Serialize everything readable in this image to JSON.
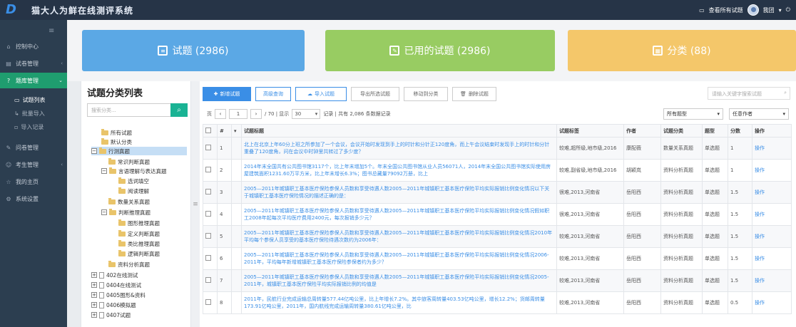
{
  "app": {
    "title": "猫大人为鲜在线测评系统",
    "view_all_label": "查看所有试题",
    "user_name": "我团"
  },
  "sidebar": {
    "items": [
      {
        "label": "控制中心",
        "icon": "home-icon"
      },
      {
        "label": "试卷管理",
        "icon": "doc-icon"
      },
      {
        "label": "题库管理",
        "icon": "help-circle-icon"
      },
      {
        "label": "问卷管理",
        "icon": "edit-icon"
      },
      {
        "label": "考生管理",
        "icon": "user-icon"
      },
      {
        "label": "我的主页",
        "icon": "star-icon"
      },
      {
        "label": "系统设置",
        "icon": "gear-icon"
      }
    ],
    "sub_items": [
      "试题列表",
      "批量导入",
      "导入记录"
    ]
  },
  "cards": [
    {
      "label": "试题 (2986)",
      "color": "#5ba8e5"
    },
    {
      "label": "已用的试题 (2986)",
      "color": "#98cc62"
    },
    {
      "label": "分类 (88)",
      "color": "#f4c76a"
    }
  ],
  "tree": {
    "title": "试题分类列表",
    "search_placeholder": "搜索分类...",
    "nodes": [
      "所有试题",
      "默认分类",
      "行测真题",
      "常识判断真题",
      "言语理解与表达真题",
      "选词填空",
      "阅读理解",
      "数量关系真题",
      "判断推理真题",
      "图形推理真题",
      "定义判断真题",
      "类比推理真题",
      "逻辑判断真题",
      "资料分析真题",
      "402在线测试",
      "0404在线测试",
      "0405图形&资料",
      "0406模拟题",
      "0407试题"
    ]
  },
  "toolbar": {
    "new_label": "新增试题",
    "search_label": "高级查询",
    "import_label": "导入试题",
    "export_label": "导出所选试题",
    "move_label": "移动到分类",
    "delete_label": "删除试题",
    "keyword_placeholder": "请输入关键字搜索试题"
  },
  "pager": {
    "page_prefix": "页",
    "prev": "‹",
    "current": "1",
    "next": "›",
    "of_text": "/ 70 | 显示",
    "page_size": "30",
    "records_text": "记录 | 共有 2,086 条数据记录"
  },
  "filters": {
    "type": "所有题型",
    "author": "任意作者"
  },
  "table": {
    "headers": [
      "#",
      "试题标题",
      "试题标签",
      "作者",
      "试题分类",
      "题型",
      "分数",
      "操作"
    ],
    "rows": [
      {
        "no": "1",
        "title": "北上在北京上年60分上班之所参加了一个会议，会议开始时发现到手上的时针和分针正120度角，而上午会议结束时发现手上的时针和分针重叠了120度角，问在会议中时钟里共转过了多少度？",
        "tags": "较难,超所级,地市级,2016",
        "author": "康配薇",
        "category": "数量关系真题",
        "type": "单选题",
        "score": "1",
        "op": "操作"
      },
      {
        "no": "2",
        "title": "2014年末全国共有公共图书馆3117个，比上年末增加5个。年末全国公共图书馆从业人员56071人，2014年末全国公共图书馆实际使用房屋建筑面积1231.60万平方米，比上年末增长6.3%；图书总藏量79092万册，比上",
        "tags": "较难,副省级,地市级,2016",
        "author": "胡颖岚",
        "category": "资料分析真题",
        "type": "单选题",
        "score": "1",
        "op": "操作"
      },
      {
        "no": "3",
        "title": "2005—2011年城镇职工基本医疗保险参保人员数和享受待遇人数2005—2011年城镇职工基本医疗保险平均实际报销比例变化情况以下关于城镇职工基本医疗保险情况的描述正确的是：",
        "tags": "很难,2013,河南省",
        "author": "岳阳西",
        "category": "资料分析真题",
        "type": "单选题",
        "score": "1.5",
        "op": "操作"
      },
      {
        "no": "4",
        "title": "2005—2011年城镇职工基本医疗保险参保人员数和享受待遇人数2005—2011年城镇职工基本医疗保险平均实际报销比例变化情况假如职工2008年起每次平均医疗费用2400元，每次报销多少元？",
        "tags": "很难,2013,河南省",
        "author": "岳阳西",
        "category": "资料分析真题",
        "type": "单选题",
        "score": "1.5",
        "op": "操作"
      },
      {
        "no": "5",
        "title": "2005—2011年城镇职工基本医疗保险参保人员数和享受待遇人数2005—2011年城镇职工基本医疗保险平均实际报销比例变化情况2010年平均每个参保人员享受的基本医疗保险待遇次数约为2006年：",
        "tags": "较难,2013,河南省",
        "author": "岳阳西",
        "category": "资料分析真题",
        "type": "单选题",
        "score": "1.5",
        "op": "操作"
      },
      {
        "no": "6",
        "title": "2005—2011年城镇职工基本医疗保险参保人员数和享受待遇人数2005—2011年城镇职工基本医疗保险平均实际报销比例变化情况2006-2011年，平均每年新增城镇职工基本医疗保险参保者约为多少？",
        "tags": "较难,2013,河南省",
        "author": "岳阳西",
        "category": "资料分析真题",
        "type": "单选题",
        "score": "1.5",
        "op": "操作"
      },
      {
        "no": "7",
        "title": "2005—2011年城镇职工基本医疗保险参保人员数和享受待遇人数2005—2011年城镇职工基本医疗保险平均实际报销比例变化情况2005-2011年，城镇职工基本医疗保险平均实际报销比例的均值是",
        "tags": "较难,2013,河南省",
        "author": "岳阳西",
        "category": "资料分析真题",
        "type": "单选题",
        "score": "1.5",
        "op": "操作"
      },
      {
        "no": "8",
        "title": "2011年，民航行业完成运输总周转量577.44亿吨公里，比上年增长7.2%。其中旅客周转量403.53亿吨公里，增长12.2%；货邮周转量173.91亿吨公里，2011年，国内航线完成运输周转量380.61亿吨公里，比",
        "tags": "较难,2013,河南省",
        "author": "岳阳西",
        "category": "资料分析真题",
        "type": "单选题",
        "score": "0.5",
        "op": "操作"
      }
    ]
  }
}
